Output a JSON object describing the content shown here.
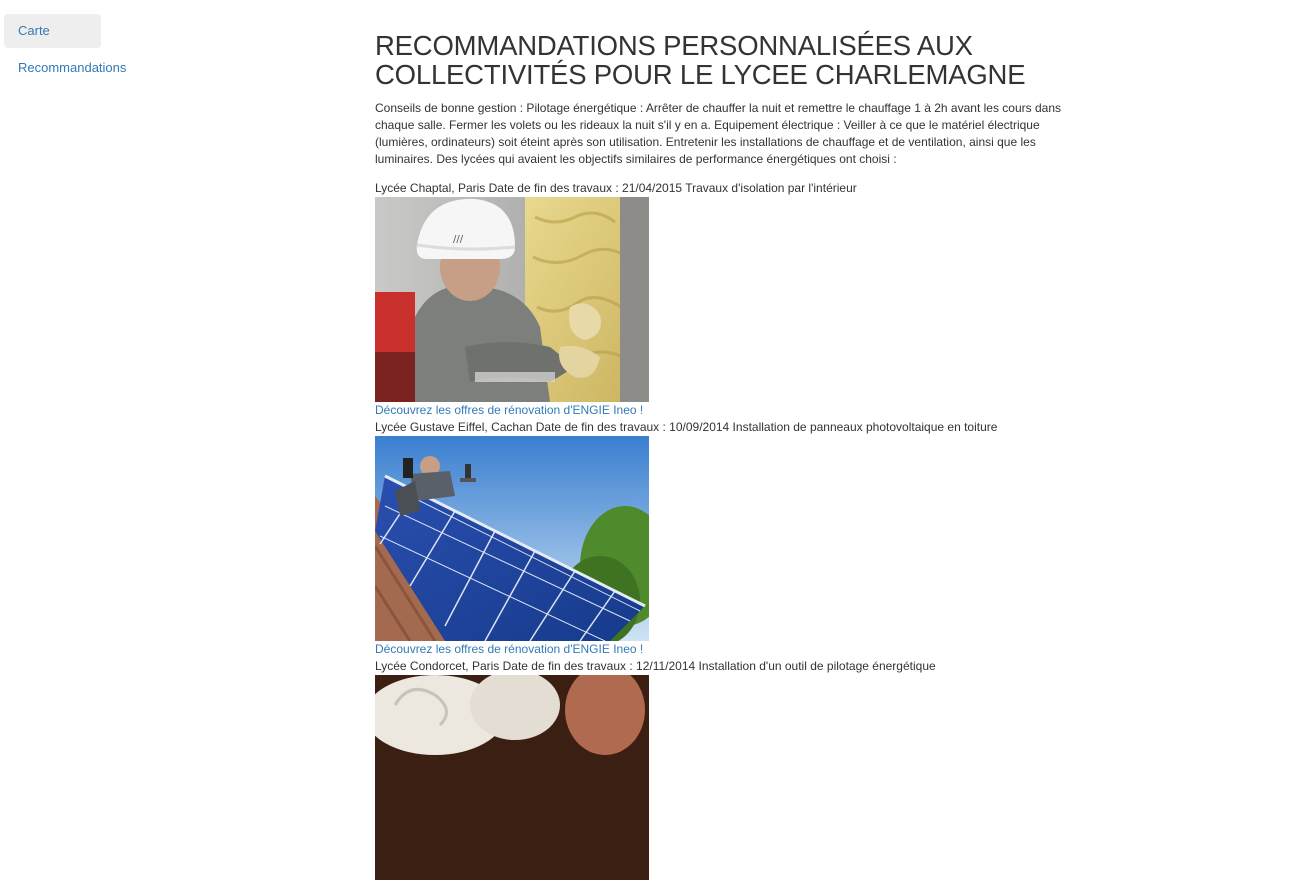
{
  "sidebar": {
    "items": [
      {
        "label": "Carte",
        "active": true
      },
      {
        "label": "Recommandations",
        "active": false
      }
    ]
  },
  "main": {
    "title": "RECOMMANDATIONS PERSONNALISÉES AUX COLLECTIVITÉS POUR LE LYCEE CHARLEMAGNE",
    "intro": "Conseils de bonne gestion : Pilotage énergétique : Arrêter de chauffer la nuit et remettre le chauffage 1 à 2h avant les cours dans chaque salle. Fermer les volets ou les rideaux la nuit s'il y en a. Equipement électrique : Veiller à ce que le matériel électrique (lumières, ordinateurs) soit éteint après son utilisation. Entretenir les installations de chauffage et de ventilation, ainsi que les luminaires. Des lycées qui avaient les objectifs similaires de performance énergétiques ont choisi :",
    "recommendations": [
      {
        "title": "Lycée Chaptal, Paris Date de fin des travaux : 21/04/2015 Travaux d'isolation par l'intérieur",
        "image": "insulation-work-photo",
        "link": "Découvrez les offres de rénovation d'ENGIE Ineo !"
      },
      {
        "title": "Lycée Gustave Eiffel, Cachan Date de fin des travaux : 10/09/2014 Installation de panneaux photovoltaique en toiture",
        "image": "solar-panels-photo",
        "link": "Découvrez les offres de rénovation d'ENGIE Ineo !"
      },
      {
        "title": "Lycée Condorcet, Paris Date de fin des travaux : 12/11/2014 Installation d'un outil de pilotage énergétique",
        "image": "energy-control-photo"
      }
    ]
  },
  "colors": {
    "link": "#337ab7",
    "text": "#333333",
    "active_nav_bg": "#eeeeee"
  }
}
